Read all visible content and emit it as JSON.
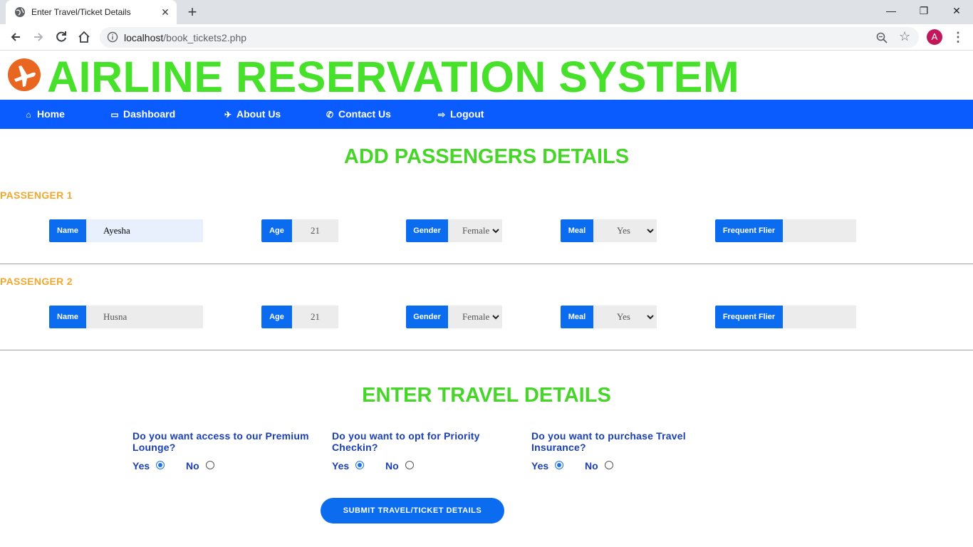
{
  "browser": {
    "tab_title": "Enter Travel/Ticket Details",
    "url_host": "localhost",
    "url_path": "/book_tickets2.php",
    "avatar_letter": "A"
  },
  "site": {
    "title": "AIRLINE RESERVATION SYSTEM"
  },
  "nav": [
    {
      "label": "Home",
      "icon": "home-icon"
    },
    {
      "label": "Dashboard",
      "icon": "monitor-icon"
    },
    {
      "label": "About Us",
      "icon": "plane-icon"
    },
    {
      "label": "Contact Us",
      "icon": "phone-icon"
    },
    {
      "label": "Logout",
      "icon": "logout-icon"
    }
  ],
  "passengers_heading": "ADD PASSENGERS DETAILS",
  "field_labels": {
    "name": "Name",
    "age": "Age",
    "gender": "Gender",
    "meal": "Meal",
    "frequent_flier": "Frequent Flier"
  },
  "passengers": [
    {
      "label": "PASSENGER 1",
      "name": "Ayesha",
      "age": "21",
      "gender": "Female",
      "meal": "Yes",
      "frequent_flier": ""
    },
    {
      "label": "PASSENGER 2",
      "name": "Husna",
      "age": "21",
      "gender": "Female",
      "meal": "Yes",
      "frequent_flier": ""
    }
  ],
  "travel_heading": "ENTER TRAVEL DETAILS",
  "questions": [
    {
      "text": "Do you want access to our Premium Lounge?",
      "yes": "Yes",
      "no": "No",
      "selected": "yes"
    },
    {
      "text": "Do you want to opt for Priority Checkin?",
      "yes": "Yes",
      "no": "No",
      "selected": "yes"
    },
    {
      "text": "Do you want to purchase Travel Insurance?",
      "yes": "Yes",
      "no": "No",
      "selected": "yes"
    }
  ],
  "submit_label": "SUBMIT TRAVEL/TICKET DETAILS",
  "colors": {
    "brand_green": "#47e02a",
    "nav_blue": "#0b5cff",
    "label_blue": "#0b6cf0",
    "passenger_orange": "#f0a830",
    "question_blue": "#1a3fb5"
  }
}
